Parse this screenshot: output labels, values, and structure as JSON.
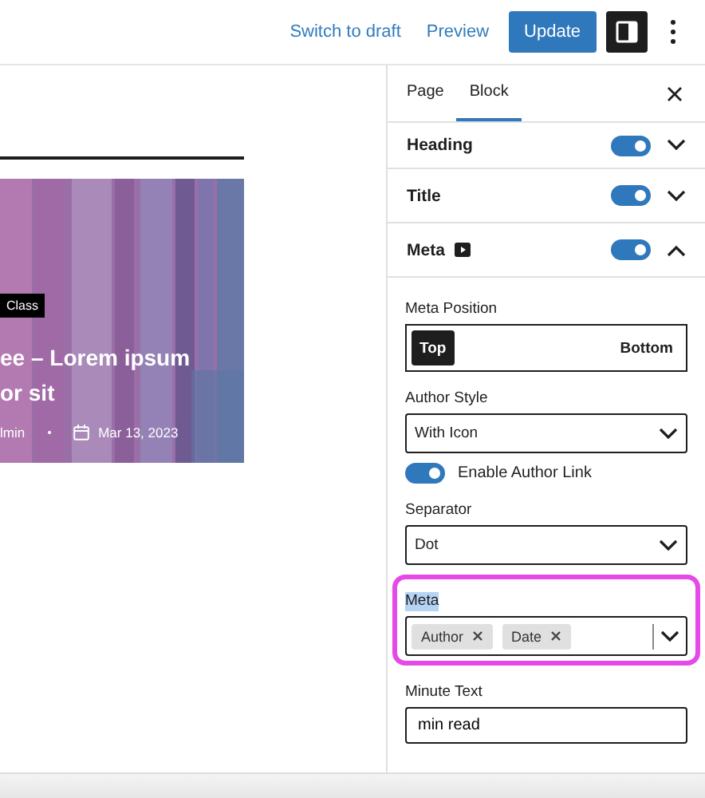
{
  "topbar": {
    "actions": [
      {
        "label": "Switch to draft",
        "kind": "link"
      },
      {
        "label": "Preview",
        "kind": "link"
      },
      {
        "label": "Update",
        "kind": "primary"
      }
    ],
    "settings_toggle": {
      "selected": true
    }
  },
  "post_card": {
    "category": "Class",
    "title": "ee – Lorem ipsum or sit",
    "author": "lmin",
    "date": "Mar 13, 2023"
  },
  "sidebar": {
    "tabs": [
      {
        "label": "Page",
        "selected": false
      },
      {
        "label": "Block",
        "selected": true
      }
    ],
    "panels": [
      {
        "title": "Heading",
        "has_icon": false,
        "on": true,
        "expanded": false
      },
      {
        "title": "Title",
        "has_icon": false,
        "on": true,
        "expanded": false
      },
      {
        "title": "Meta",
        "has_icon": true,
        "on": true,
        "expanded": true
      }
    ],
    "controls": [
      {
        "kind": "segmented",
        "label": "Meta Position",
        "options": [
          {
            "label": "Top",
            "selected": true
          },
          {
            "label": "Bottom",
            "selected": false
          }
        ]
      },
      {
        "kind": "select",
        "label": "Author Style",
        "value": "With Icon"
      },
      {
        "kind": "toggle",
        "label": "Enable Author Link",
        "on": true
      },
      {
        "kind": "select",
        "label": "Separator",
        "value": "Dot"
      },
      {
        "kind": "tokens",
        "label": "Meta",
        "label_selected": true,
        "highlighted": true,
        "tokens": [
          "Author",
          "Date"
        ]
      },
      {
        "kind": "input",
        "label": "Minute Text",
        "value": "min read"
      }
    ]
  }
}
